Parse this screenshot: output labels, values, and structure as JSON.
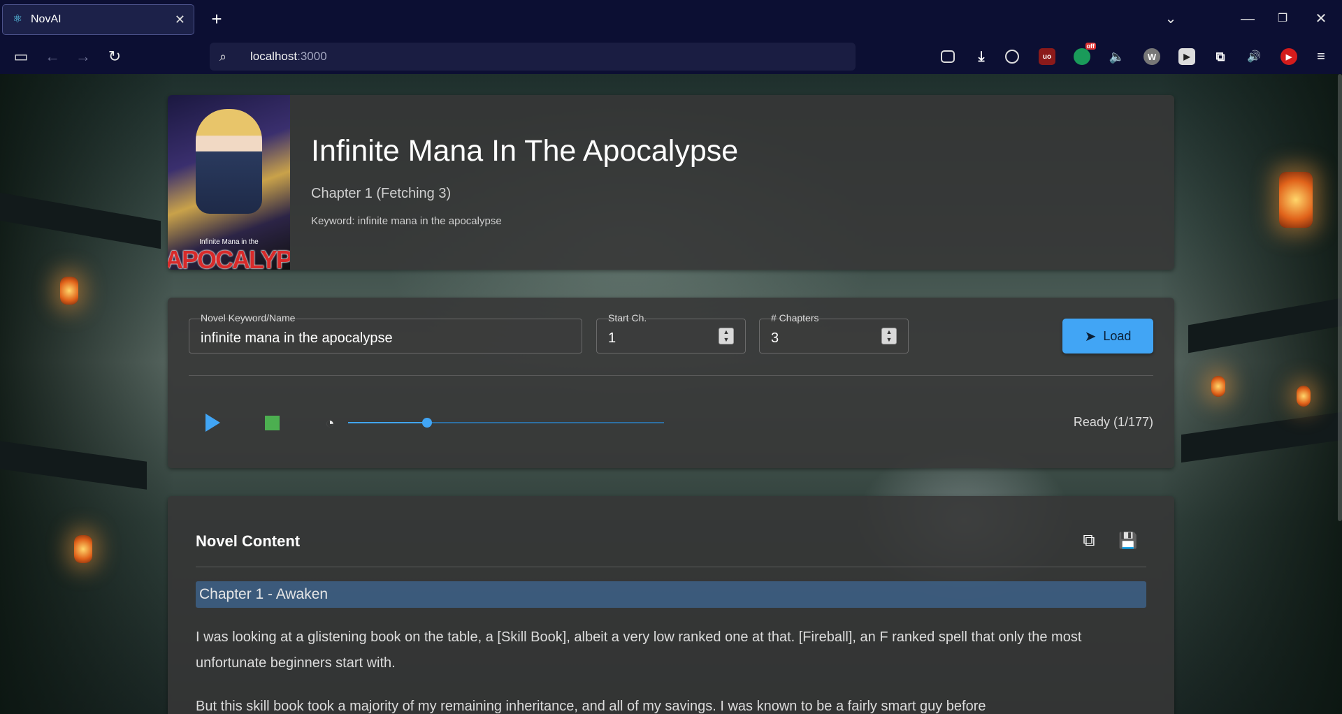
{
  "browser": {
    "tab_title": "NovAI",
    "url_host": "localhost",
    "url_port": ":3000",
    "extensions": [
      "pocket-icon",
      "download-icon",
      "account-icon",
      "ublock-icon",
      "grammarly-icon",
      "sound-icon",
      "wikipedia-icon",
      "youtube-icon",
      "extensions-icon",
      "volume-icon",
      "adblock-icon",
      "menu-icon"
    ],
    "ublock_badge": "uo",
    "grammarly_badge": "off",
    "wiki_letter": "W"
  },
  "novel": {
    "cover_subtitle": "Infinite Mana in the",
    "cover_title": "APOCALYPSE",
    "title": "Infinite Mana In The Apocalypse",
    "chapter_info": "Chapter 1 (Fetching 3)",
    "keyword_info": "Keyword: infinite mana in the apocalypse"
  },
  "controls": {
    "keyword_label": "Novel Keyword/Name",
    "keyword_value": "infinite mana in the apocalypse",
    "start_label": "Start Ch.",
    "start_value": "1",
    "chapters_label": "# Chapters",
    "chapters_value": "3",
    "load_label": "Load",
    "speed_fraction": 0.25,
    "status": "Ready (1/177)"
  },
  "content": {
    "title": "Novel Content",
    "chapter_heading": "Chapter 1 - Awaken",
    "paragraphs": [
      "I was looking at a glistening book on the table, a [Skill Book], albeit a very low ranked one at that. [Fireball], an F ranked spell that only the most unfortunate beginners start with.",
      "But this skill book took a majority of my remaining inheritance, and all of my savings. I was known to be a fairly smart guy before"
    ]
  },
  "colors": {
    "accent": "#41a5f5",
    "stop": "#4caf50",
    "card_bg": "#373737"
  }
}
